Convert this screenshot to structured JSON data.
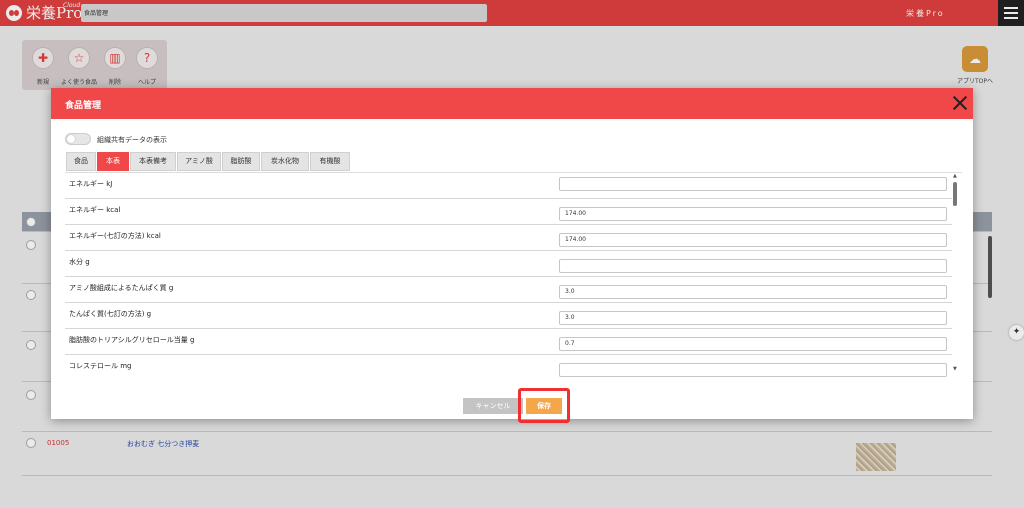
{
  "app": {
    "logo_text": "栄養Pro",
    "logo_cloud": "Cloud",
    "breadcrumb": "食品管理",
    "user_label": "栄養Pro"
  },
  "toolbar": {
    "items": [
      {
        "label": "新規",
        "icon": "add-food-icon"
      },
      {
        "label": "よく使う食品",
        "icon": "star-icon"
      },
      {
        "label": "削除",
        "icon": "trash-icon"
      },
      {
        "label": "ヘルプ",
        "icon": "help-icon"
      }
    ],
    "app_top_label": "アプリTOPへ"
  },
  "background_list": {
    "rows": [
      {
        "code": "01005",
        "name": "おおむぎ 七分つき押麦"
      }
    ]
  },
  "modal": {
    "title": "食品管理",
    "share_toggle_label": "組織共有データの表示",
    "tabs": [
      "食品",
      "本表",
      "本表備考",
      "アミノ酸",
      "脂肪酸",
      "炭水化物",
      "有機酸"
    ],
    "active_tab": "本表",
    "fields": [
      {
        "label": "エネルギー kJ",
        "value": ""
      },
      {
        "label": "エネルギー kcal",
        "value": "174.00"
      },
      {
        "label": "エネルギー(七訂の方法) kcal",
        "value": "174.00"
      },
      {
        "label": "水分 g",
        "value": ""
      },
      {
        "label": "アミノ酸組成によるたんぱく質 g",
        "value": "3.0"
      },
      {
        "label": "たんぱく質(七訂の方法) g",
        "value": "3.0"
      },
      {
        "label": "脂肪酸のトリアシルグリセロール当量 g",
        "value": "0.7"
      },
      {
        "label": "コレステロール mg",
        "value": ""
      }
    ],
    "cancel_label": "キャンセル",
    "save_label": "保存"
  },
  "colors": {
    "header_red": "#e0403f",
    "modal_red": "#f04848",
    "save_orange": "#f4a64a",
    "highlight_red": "#f03030"
  }
}
